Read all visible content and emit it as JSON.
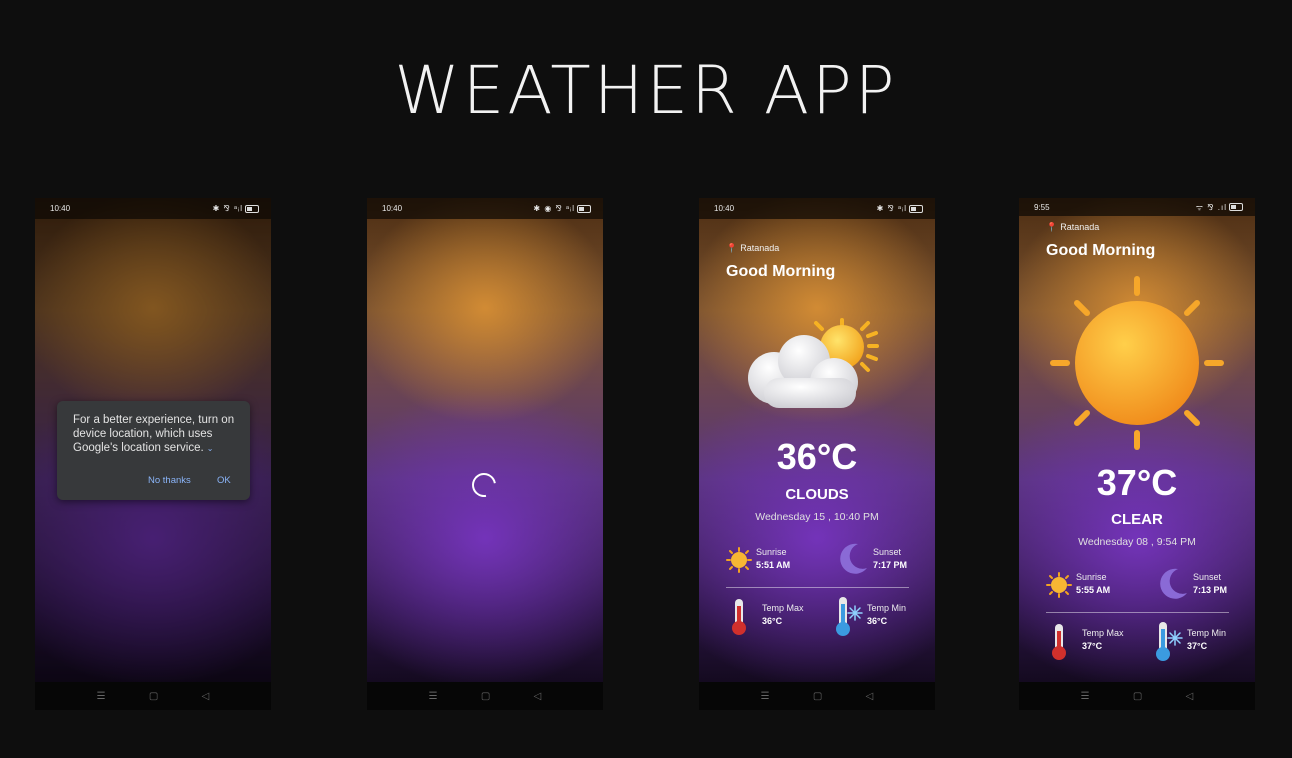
{
  "title": "WEATHER APP",
  "nav_symbols": [
    "☰",
    "▢",
    "◁"
  ],
  "screens": [
    {
      "time": "10:40",
      "status_icons": "✱ ⅋ ᵃᵢl",
      "dialog": {
        "message": "For a better experience, turn on device location, which uses Google's location service.",
        "no_label": "No thanks",
        "ok_label": "OK"
      }
    },
    {
      "time": "10:40",
      "status_icons": "✱ ◉ ⅋ ᵃᵢl"
    },
    {
      "time": "10:40",
      "status_icons": "✱ ⅋ ᵃᵢl",
      "location": "Ratanada",
      "greeting": "Good Morning",
      "temperature": "36°C",
      "condition": "CLOUDS",
      "datetime": "Wednesday 15 , 10:40 PM",
      "sunrise_label": "Sunrise",
      "sunrise": "5:51 AM",
      "sunset_label": "Sunset",
      "sunset": "7:17 PM",
      "temp_max_label": "Temp Max",
      "temp_max": "36°C",
      "temp_min_label": "Temp Min",
      "temp_min": "36°C"
    },
    {
      "time": "9:55",
      "status_icons": "ᯤ ⅋ .ıl",
      "location": "Ratanada",
      "greeting": "Good Morning",
      "temperature": "37°C",
      "condition": "CLEAR",
      "datetime": "Wednesday 08 , 9:54 PM",
      "sunrise_label": "Sunrise",
      "sunrise": "5:55 AM",
      "sunset_label": "Sunset",
      "sunset": "7:13 PM",
      "temp_max_label": "Temp Max",
      "temp_max": "37°C",
      "temp_min_label": "Temp Min",
      "temp_min": "37°C"
    }
  ]
}
